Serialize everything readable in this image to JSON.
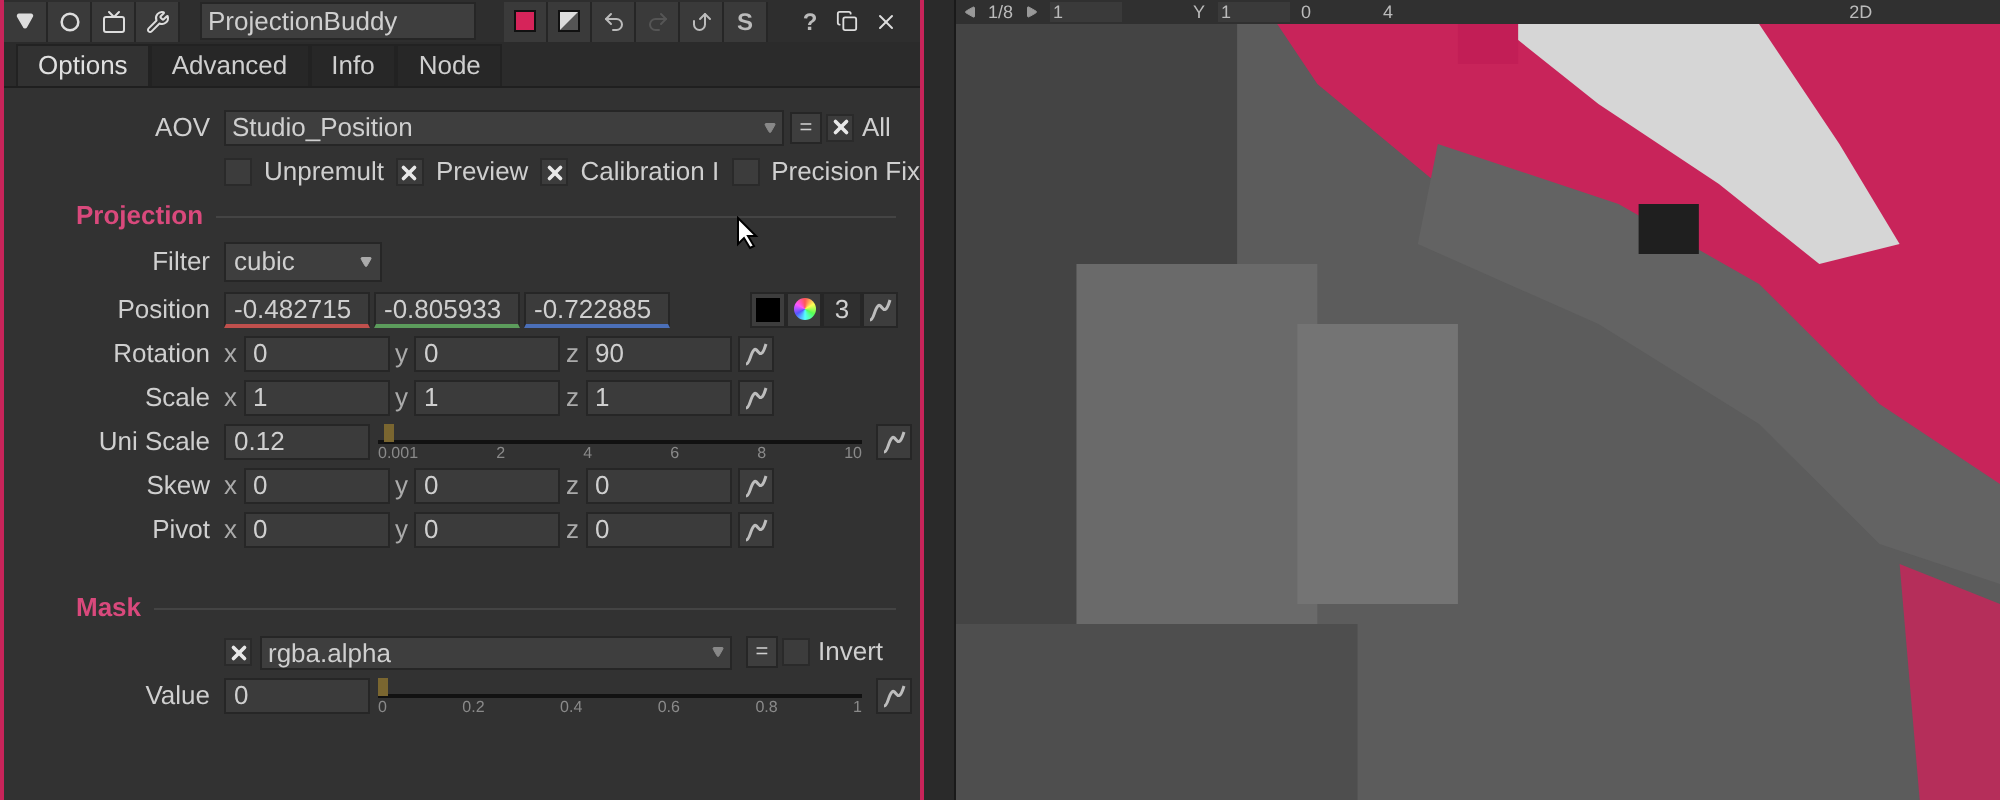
{
  "panel": {
    "node_name": "ProjectionBuddy",
    "stamp_label": "S",
    "help_label": "?"
  },
  "tabs": [
    {
      "label": "Options",
      "selected": true
    },
    {
      "label": "Advanced",
      "selected": false
    },
    {
      "label": "Info",
      "selected": false
    },
    {
      "label": "Node",
      "selected": false
    }
  ],
  "aov": {
    "label": "AOV",
    "value": "Studio_Position",
    "link_label": "=",
    "all": {
      "label": "All",
      "checked": true
    }
  },
  "checkboxes": [
    {
      "label": "Unpremult",
      "checked": false
    },
    {
      "label": "Preview",
      "checked": true
    },
    {
      "label": "Calibration I",
      "checked": true
    },
    {
      "label": "Precision Fix",
      "checked": false
    }
  ],
  "projection": {
    "title": "Projection",
    "filter": {
      "label": "Filter",
      "value": "cubic"
    },
    "position": {
      "label": "Position",
      "values": [
        "-0.482715",
        "-0.805933",
        "-0.722885"
      ],
      "count": "3"
    },
    "rows": [
      {
        "kind": "xyz",
        "label": "Rotation",
        "fields": [
          {
            "axis": "x",
            "value": "0"
          },
          {
            "axis": "y",
            "value": "0"
          },
          {
            "axis": "z",
            "value": "90"
          }
        ]
      },
      {
        "kind": "xyz",
        "label": "Scale",
        "fields": [
          {
            "axis": "x",
            "value": "1"
          },
          {
            "axis": "y",
            "value": "1"
          },
          {
            "axis": "z",
            "value": "1"
          }
        ]
      },
      {
        "kind": "slider",
        "label": "Uni Scale",
        "value": "0.12",
        "level": 0.012,
        "ticks": [
          "0.001",
          "2",
          "4",
          "6",
          "8",
          "10"
        ]
      },
      {
        "kind": "xyz",
        "label": "Skew",
        "fields": [
          {
            "axis": "x",
            "value": "0"
          },
          {
            "axis": "y",
            "value": "0"
          },
          {
            "axis": "z",
            "value": "0"
          }
        ]
      },
      {
        "kind": "xyz",
        "label": "Pivot",
        "fields": [
          {
            "axis": "x",
            "value": "0"
          },
          {
            "axis": "y",
            "value": "0"
          },
          {
            "axis": "z",
            "value": "0"
          }
        ]
      }
    ]
  },
  "mask": {
    "title": "Mask",
    "enabled": true,
    "channel": "rgba.alpha",
    "link_label": "=",
    "invert": {
      "label": "Invert",
      "checked": false
    },
    "value_row": {
      "kind": "slider",
      "label": "Value",
      "value": "0",
      "level": 0,
      "ticks": [
        "0",
        "0.2",
        "0.4",
        "0.6",
        "0.8",
        "1"
      ]
    }
  },
  "viewer": {
    "frame": "1/8",
    "gain": "1",
    "gamma_label": "Y",
    "gamma": "1",
    "slider_min": "0",
    "slider_max": "4",
    "view_mode": "2D"
  }
}
